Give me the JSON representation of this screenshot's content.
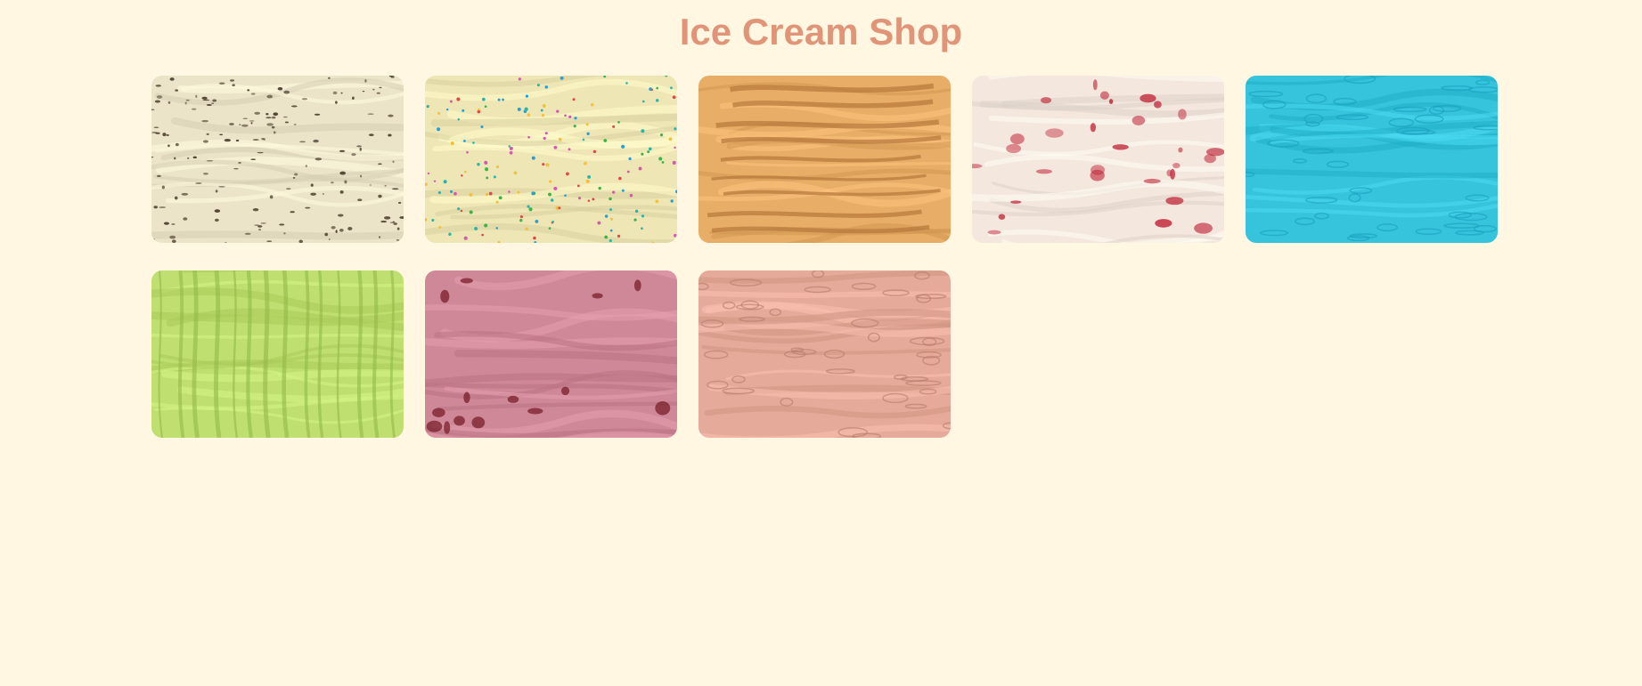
{
  "header": {
    "title": "Ice Cream Shop"
  },
  "flavors": [
    {
      "icon": "cookies-and-cream-texture",
      "base": "#ece4c8",
      "accent": "#4a3a2c",
      "pattern": "flecks"
    },
    {
      "icon": "vanilla-sprinkles-texture",
      "base": "#eee6b4",
      "accent": "#d9cf8e",
      "pattern": "sprinkles"
    },
    {
      "icon": "peanut-butter-texture",
      "base": "#e8ad66",
      "accent": "#b7783a",
      "pattern": "ridges"
    },
    {
      "icon": "cherry-swirl-texture",
      "base": "#f3e7de",
      "accent": "#c22a3c",
      "pattern": "swirl"
    },
    {
      "icon": "blue-raspberry-texture",
      "base": "#35c4dc",
      "accent": "#1a9fbc",
      "pattern": "ripples"
    },
    {
      "icon": "pistachio-texture",
      "base": "#bfe070",
      "accent": "#93b94a",
      "pattern": "vertical"
    },
    {
      "icon": "strawberry-chunk-texture",
      "base": "#cf8898",
      "accent": "#7a1f2c",
      "pattern": "chunks"
    },
    {
      "icon": "chocolate-texture",
      "base": "#e6aa9a",
      "accent": "#b57b6b",
      "pattern": "ripples"
    }
  ],
  "colors": {
    "background": "#fff7e1",
    "title": "#e09478"
  }
}
